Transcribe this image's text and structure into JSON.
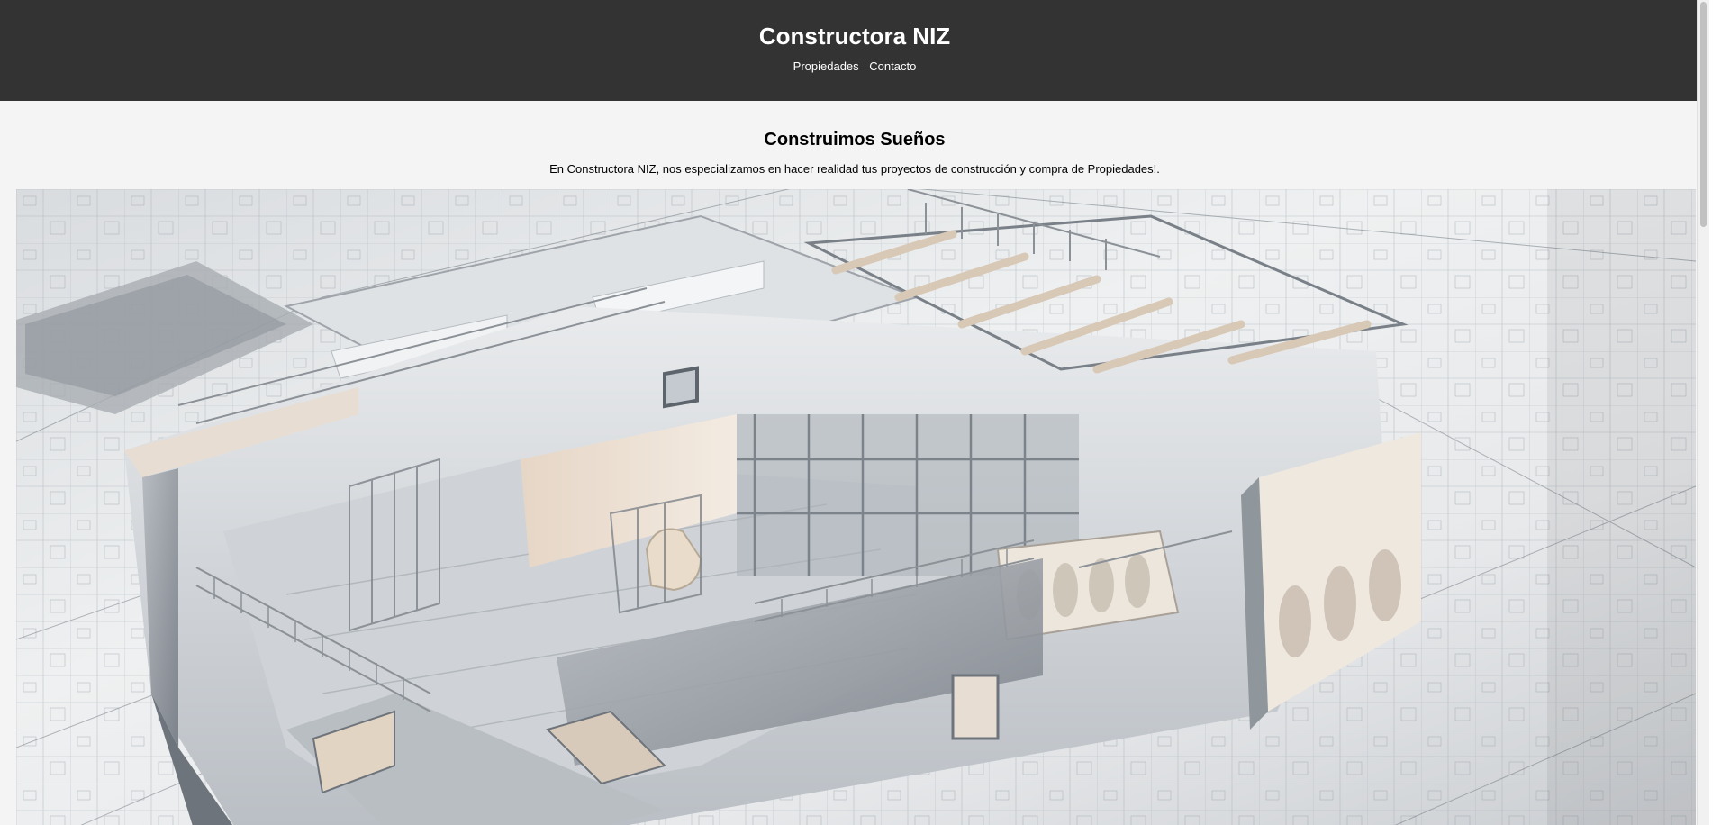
{
  "header": {
    "title": "Constructora NIZ",
    "nav": [
      {
        "label": "Propiedades"
      },
      {
        "label": "Contacto"
      }
    ]
  },
  "hero": {
    "heading": "Construimos Sueños",
    "text": "En Constructora NIZ, nos especializamos en hacer realidad tus proyectos de construcción y compra de Propiedades!."
  },
  "colors": {
    "header_bg": "#333333",
    "page_bg": "#f4f4f4"
  }
}
